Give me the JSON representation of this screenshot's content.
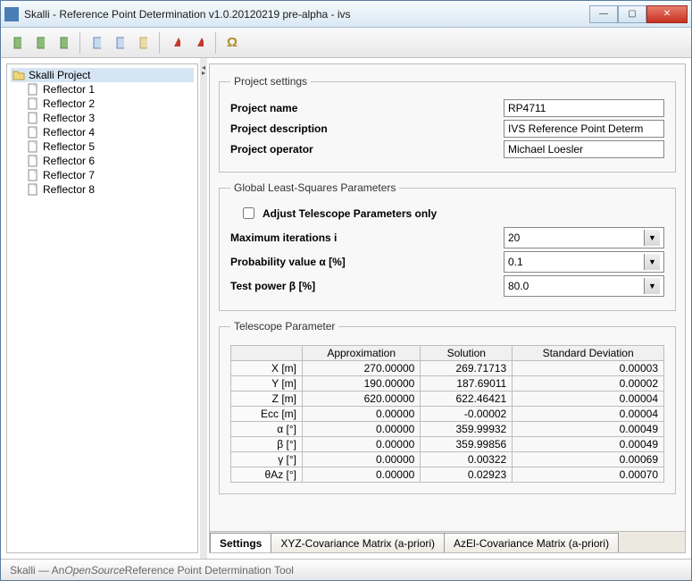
{
  "title": "Skalli - Reference Point Determination v1.0.20120219 pre-alpha - ivs",
  "tree": {
    "root": "Skalli Project",
    "items": [
      "Reflector 1",
      "Reflector 2",
      "Reflector 3",
      "Reflector 4",
      "Reflector 5",
      "Reflector 6",
      "Reflector 7",
      "Reflector 8"
    ]
  },
  "project": {
    "legend": "Project settings",
    "name_label": "Project name",
    "name_value": "RP4711",
    "desc_label": "Project description",
    "desc_value": "IVS Reference Point Determ",
    "operator_label": "Project operator",
    "operator_value": "Michael Loesler"
  },
  "glsp": {
    "legend": "Global Least-Squares Parameters",
    "adjust_label": "Adjust Telescope Parameters only",
    "maxiter_label": "Maximum iterations i",
    "maxiter_value": "20",
    "prob_label": "Probability value α [%]",
    "prob_value": "0.1",
    "power_label": "Test power β [%]",
    "power_value": "80.0"
  },
  "telescope": {
    "legend": "Telescope Parameter",
    "headers": {
      "approx": "Approximation",
      "solution": "Solution",
      "std": "Standard Deviation"
    },
    "rows": [
      {
        "label": "X [m]",
        "approx": "270.00000",
        "sol": "269.71713",
        "std": "0.00003"
      },
      {
        "label": "Y [m]",
        "approx": "190.00000",
        "sol": "187.69011",
        "std": "0.00002"
      },
      {
        "label": "Z [m]",
        "approx": "620.00000",
        "sol": "622.46421",
        "std": "0.00004"
      },
      {
        "label": "Ecc [m]",
        "approx": "0.00000",
        "sol": "-0.00002",
        "std": "0.00004"
      },
      {
        "label": "α [°]",
        "approx": "0.00000",
        "sol": "359.99932",
        "std": "0.00049"
      },
      {
        "label": "β [°]",
        "approx": "0.00000",
        "sol": "359.99856",
        "std": "0.00049"
      },
      {
        "label": "γ [°]",
        "approx": "0.00000",
        "sol": "0.00322",
        "std": "0.00069"
      },
      {
        "label": "θAz [°]",
        "approx": "0.00000",
        "sol": "0.02923",
        "std": "0.00070"
      }
    ]
  },
  "tabs": {
    "settings": "Settings",
    "xyz": "XYZ-Covariance Matrix (a-priori)",
    "azel": "AzEl-Covariance Matrix (a-priori)"
  },
  "status": {
    "pre": "Skalli — An ",
    "italic": "OpenSource",
    "post": " Reference Point Determination Tool"
  }
}
